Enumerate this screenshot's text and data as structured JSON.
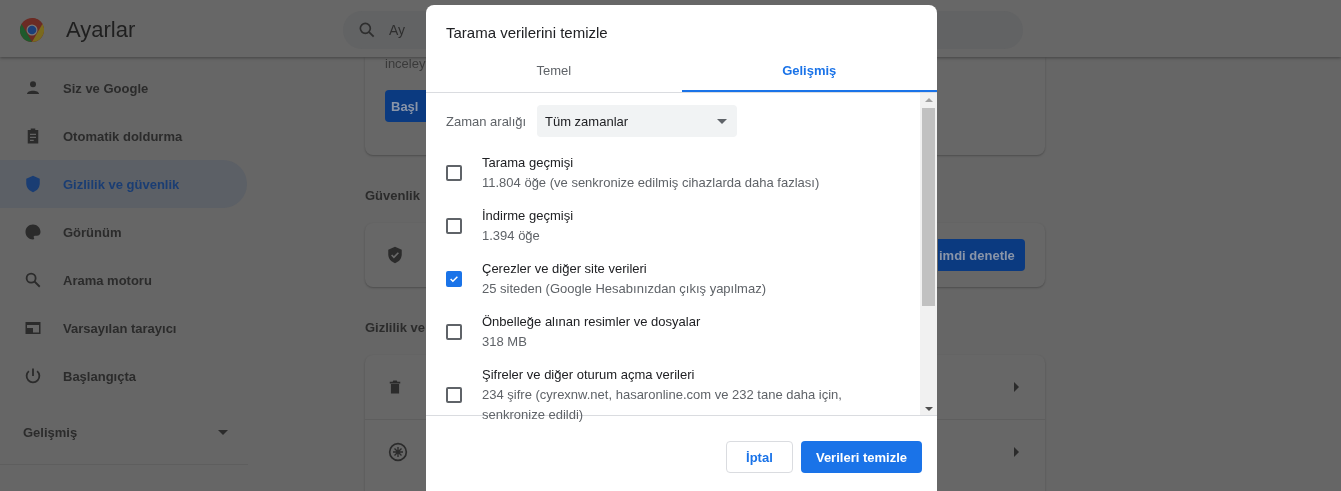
{
  "header": {
    "title": "Ayarlar",
    "search": {
      "value": "Ay"
    }
  },
  "sidebar": {
    "items": [
      {
        "label": "Siz ve Google",
        "selected": false
      },
      {
        "label": "Otomatik doldurma",
        "selected": false
      },
      {
        "label": "Gizlilik ve güvenlik",
        "selected": true
      },
      {
        "label": "Görünüm",
        "selected": false
      },
      {
        "label": "Arama motoru",
        "selected": false
      },
      {
        "label": "Varsayılan tarayıcı",
        "selected": false
      },
      {
        "label": "Başlangıçta",
        "selected": false
      }
    ],
    "advanced": {
      "label": "Gelişmiş"
    }
  },
  "main": {
    "intro_card": {
      "text": "inceley",
      "button": "Başl"
    },
    "safety": {
      "heading": "Güvenlik",
      "button": "imdi denetle"
    },
    "privacy": {
      "heading": "Gizlilik ve"
    }
  },
  "dialog": {
    "title": "Tarama verilerini temizle",
    "tabs": [
      {
        "label": "Temel",
        "selected": false
      },
      {
        "label": "Gelişmiş",
        "selected": true
      }
    ],
    "time_range": {
      "label": "Zaman aralığı",
      "value": "Tüm zamanlar"
    },
    "items": [
      {
        "title": "Tarama geçmişi",
        "detail": "11.804 öğe (ve senkronize edilmiş cihazlarda daha fazlası)",
        "checked": false
      },
      {
        "title": "İndirme geçmişi",
        "detail": "1.394 öğe",
        "checked": false
      },
      {
        "title": "Çerezler ve diğer site verileri",
        "detail": "25 siteden (Google Hesabınızdan çıkış yapılmaz)",
        "checked": true
      },
      {
        "title": "Önbelleğe alınan resimler ve dosyalar",
        "detail": "318 MB",
        "checked": false
      },
      {
        "title": "Şifreler ve diğer oturum açma verileri",
        "detail": "234 şifre (cyrexnw.net, hasaronline.com ve 232 tane daha için, senkronize edildi)",
        "checked": false
      }
    ],
    "buttons": [
      {
        "label": "İptal",
        "kind": "secondary"
      },
      {
        "label": "Verileri temizle",
        "kind": "primary"
      }
    ]
  }
}
